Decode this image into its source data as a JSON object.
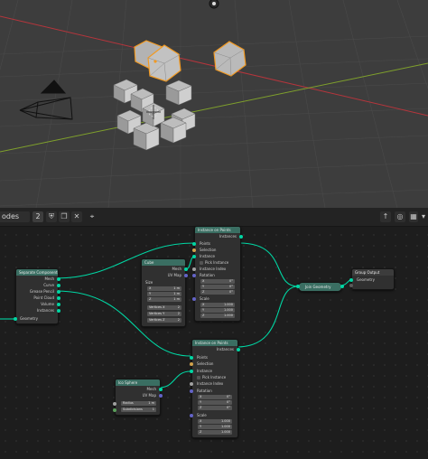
{
  "header": {
    "tree_name": "odes",
    "users_count": "2",
    "shield_icon": "shield-icon",
    "copy_icon": "copy-icon",
    "close_icon": "close-icon",
    "pin_icon": "pin-icon"
  },
  "colors": {
    "viewport_bg": "#3d3d3d",
    "editor_bg": "#1d1d1d",
    "geometry_socket": "#00d6a3",
    "vector_socket": "#6363c7",
    "float_socket": "#a1a1a1",
    "selection_outline": "#f29a22",
    "x_axis": "#b5353c",
    "y_axis": "#7fa02c"
  },
  "nodes": {
    "separate_components": {
      "title": "Separate Components",
      "outputs": [
        "Mesh",
        "Curve",
        "Grease Pencil",
        "Point Cloud",
        "Volume",
        "Instances"
      ],
      "input": "Geometry"
    },
    "cube": {
      "title": "Cube",
      "outputs": [
        "Mesh",
        "UV Map"
      ],
      "size_label": "Size",
      "size": [
        {
          "axis": "X",
          "value": "1 m"
        },
        {
          "axis": "Y",
          "value": "1 m"
        },
        {
          "axis": "Z",
          "value": "1 m"
        }
      ],
      "vertices": [
        {
          "label": "Vertices X",
          "value": "2"
        },
        {
          "label": "Vertices Y",
          "value": "2"
        },
        {
          "label": "Vertices Z",
          "value": "2"
        }
      ]
    },
    "instance_top": {
      "title": "Instance on Points",
      "output": "Instances",
      "inputs": [
        "Points",
        "Selection",
        "Instance",
        "Pick Instance",
        "Instance Index",
        "Rotation"
      ],
      "rotation": [
        {
          "axis": "X",
          "value": "0°"
        },
        {
          "axis": "Y",
          "value": "0°"
        },
        {
          "axis": "Z",
          "value": "0°"
        }
      ],
      "scale_label": "Scale",
      "scale": [
        {
          "axis": "X",
          "value": "1.000"
        },
        {
          "axis": "Y",
          "value": "1.000"
        },
        {
          "axis": "Z",
          "value": "1.000"
        }
      ]
    },
    "instance_bottom": {
      "title": "Instance on Points",
      "output": "Instances",
      "inputs": [
        "Points",
        "Selection",
        "Instance",
        "Pick Instance",
        "Instance Index",
        "Rotation"
      ],
      "rotation": [
        {
          "axis": "X",
          "value": "0°"
        },
        {
          "axis": "Y",
          "value": "0°"
        },
        {
          "axis": "Z",
          "value": "0°"
        }
      ],
      "scale_label": "Scale",
      "scale": [
        {
          "axis": "X",
          "value": "1.000"
        },
        {
          "axis": "Y",
          "value": "1.000"
        },
        {
          "axis": "Z",
          "value": "1.000"
        }
      ]
    },
    "ico_sphere": {
      "title": "Ico Sphere",
      "outputs": [
        "Mesh",
        "UV Map"
      ],
      "radius": {
        "label": "Radius",
        "value": "1 m"
      },
      "subdivisions": {
        "label": "Subdivisions",
        "value": "1"
      }
    },
    "join_geometry": {
      "title": "Join Geometry"
    },
    "group_output": {
      "title": "Group Output",
      "input": "Geometry"
    }
  }
}
